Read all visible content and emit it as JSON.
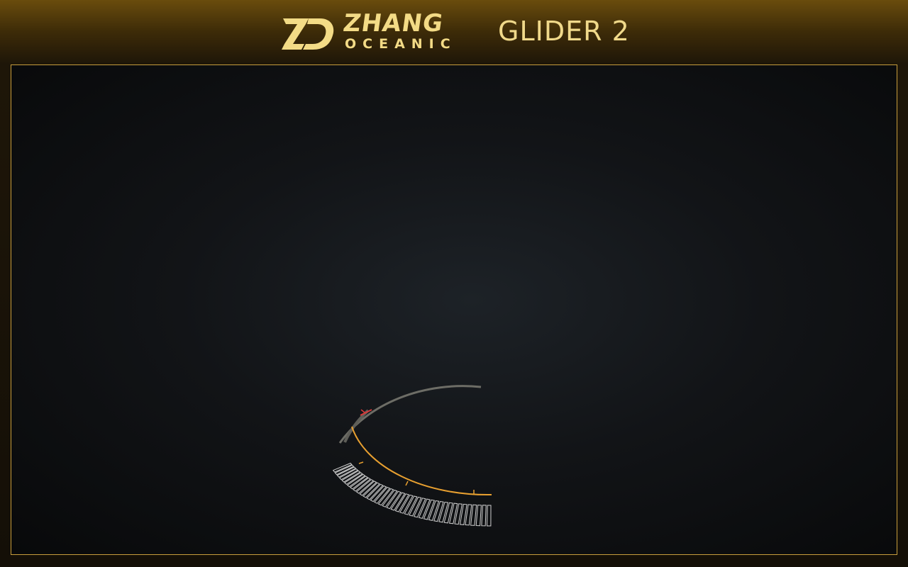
{
  "header": {
    "brand_name": "ZHANG",
    "brand_sub": "OCEANIC",
    "product_title": "GLIDER 2"
  },
  "colors": {
    "accent_gold": "#f3db86",
    "frame_border": "#c79d3c",
    "gauge_orange": "#e8a030",
    "gauge_red": "#d83a3a",
    "gauge_white": "#d8d8d8"
  },
  "icons": {
    "logo": "zd-logo-icon"
  }
}
